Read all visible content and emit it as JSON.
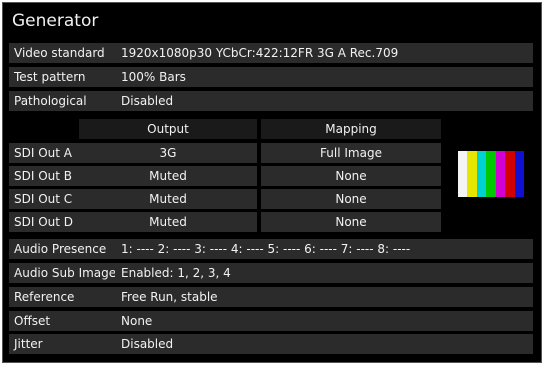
{
  "title": "Generator",
  "top_rows": [
    {
      "label": "Video standard",
      "value": "1920x1080p30 YCbCr:422:12FR 3G A Rec.709"
    },
    {
      "label": "Test pattern",
      "value": "100% Bars"
    },
    {
      "label": "Pathological",
      "value": "Disabled"
    }
  ],
  "sdi": {
    "headers": {
      "output": "Output",
      "mapping": "Mapping"
    },
    "rows": [
      {
        "label": "SDI Out A",
        "output": "3G",
        "mapping": "Full Image"
      },
      {
        "label": "SDI Out B",
        "output": "Muted",
        "mapping": "None"
      },
      {
        "label": "SDI Out C",
        "output": "Muted",
        "mapping": "None"
      },
      {
        "label": "SDI Out D",
        "output": "Muted",
        "mapping": "None"
      }
    ]
  },
  "test_pattern_preview": {
    "bar_colors": [
      "#f4f4f4",
      "#e6e600",
      "#00d2d2",
      "#00c800",
      "#d200d2",
      "#d20000",
      "#1010d2"
    ]
  },
  "bottom_rows": [
    {
      "label": "Audio Presence",
      "value": "1: ---- 2: ---- 3: ---- 4: ---- 5: ---- 6: ---- 7: ---- 8: ----"
    },
    {
      "label": "Audio Sub Images",
      "value": "Enabled: 1, 2, 3, 4"
    },
    {
      "label": "Reference",
      "value": "Free Run, stable"
    },
    {
      "label": "Offset",
      "value": "None"
    },
    {
      "label": "Jitter",
      "value": "Disabled"
    }
  ]
}
